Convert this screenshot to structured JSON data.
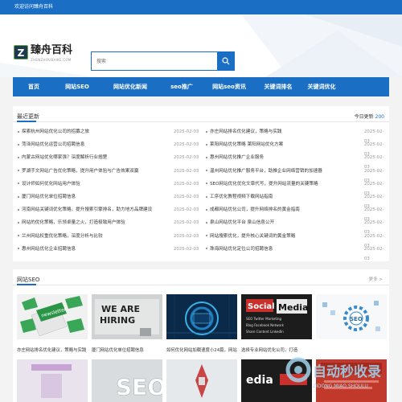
{
  "topbar": {
    "welcome": "欢迎访问臻舟百科"
  },
  "logo": {
    "mark": "Z",
    "title": "臻舟百科",
    "subtitle": "ZHENZHOUBAIKE.COM"
  },
  "search": {
    "placeholder": "搜索"
  },
  "nav": {
    "items": [
      "首页",
      "网站SEO",
      "网站优化新闻",
      "seo推广",
      "网站seo资讯",
      "关键词排名",
      "关键词优化"
    ]
  },
  "latest": {
    "title": "最近更新",
    "today_label": "今日更新",
    "today_count": "200",
    "left": [
      {
        "title": "探索杭州网站优化公司的招募之旅",
        "date": "2025-02-03"
      },
      {
        "title": "菏泽网站优化运营公司招聘信息",
        "date": "2025-02-03"
      },
      {
        "title": "内蒙古网站优化哪家强？深度解析行业翘楚",
        "date": "2025-02-03"
      },
      {
        "title": "罗湖手文网站广告优化策略，提升用户体验与广告效果双赢",
        "date": "2025-02-03"
      },
      {
        "title": "设计师如何优化网站用户体验",
        "date": "2025-02-03"
      },
      {
        "title": "厦门网站优化单位招聘信息",
        "date": "2025-02-03"
      },
      {
        "title": "河南网站关键词优化策略，提升搜索引擎排名，助力地方品牌建设",
        "date": "2025-02-03"
      },
      {
        "title": "网站的优化策略，乐领卓量之火，打造极致用户体验",
        "date": "2025-02-03"
      },
      {
        "title": "兰州网站权重优化策略，深度分析与比较",
        "date": "2025-02-03"
      },
      {
        "title": "惠州网站优化企业招聘信息",
        "date": "2025-02-03"
      }
    ],
    "right": [
      {
        "title": "亦庄网站排名优化建议，策略与实践",
        "date": "2025-02-03"
      },
      {
        "title": "莱阳网站优化策略 莱阳网站优化方案",
        "date": "2025-02-03"
      },
      {
        "title": "惠州网站优化推广企业服务",
        "date": "2025-02-03"
      },
      {
        "title": "温州网站优化推广服务平台，助推企业网络营销的加速器",
        "date": "2025-02-03"
      },
      {
        "title": "SEO网站优化优化文章代写，提升网站流量的关键策略",
        "date": "2025-02-03"
      },
      {
        "title": "工序优化教程视频下载网站指南",
        "date": "2025-02-03"
      },
      {
        "title": "成都网站优化公司，提升网络排名的黄金指南",
        "date": "2025-02-03"
      },
      {
        "title": "泉山网站优化平台 泉山信息公开",
        "date": "2025-02-03"
      },
      {
        "title": "网站搜索优化，提升核心关键词的黄金策略",
        "date": "2025-02-03"
      },
      {
        "title": "珠海网站优化定位公司招聘信息",
        "date": "2025-02-03"
      }
    ]
  },
  "seo_section": {
    "title": "网站SEO",
    "more": "更多 >",
    "cards": [
      {
        "caption": "亦庄网站排名优化建议，策略与实践",
        "image_text": ""
      },
      {
        "caption": "厦门网站优化单位招聘信息",
        "image_text": "WE ARE HIRING"
      },
      {
        "caption": "如何优化网站加载速度小24篇，网站...",
        "image_text": ""
      },
      {
        "caption": "选择专业网站优化公司，打造",
        "image_text": "Social Media"
      },
      {
        "caption": "",
        "image_text": ""
      }
    ]
  },
  "watermark": {
    "text": "自动秒收录",
    "sub": "ZIDONG  MIAO  SHOULU"
  },
  "colors": {
    "primary": "#1a6fc4",
    "background": "#f3f3f3"
  }
}
